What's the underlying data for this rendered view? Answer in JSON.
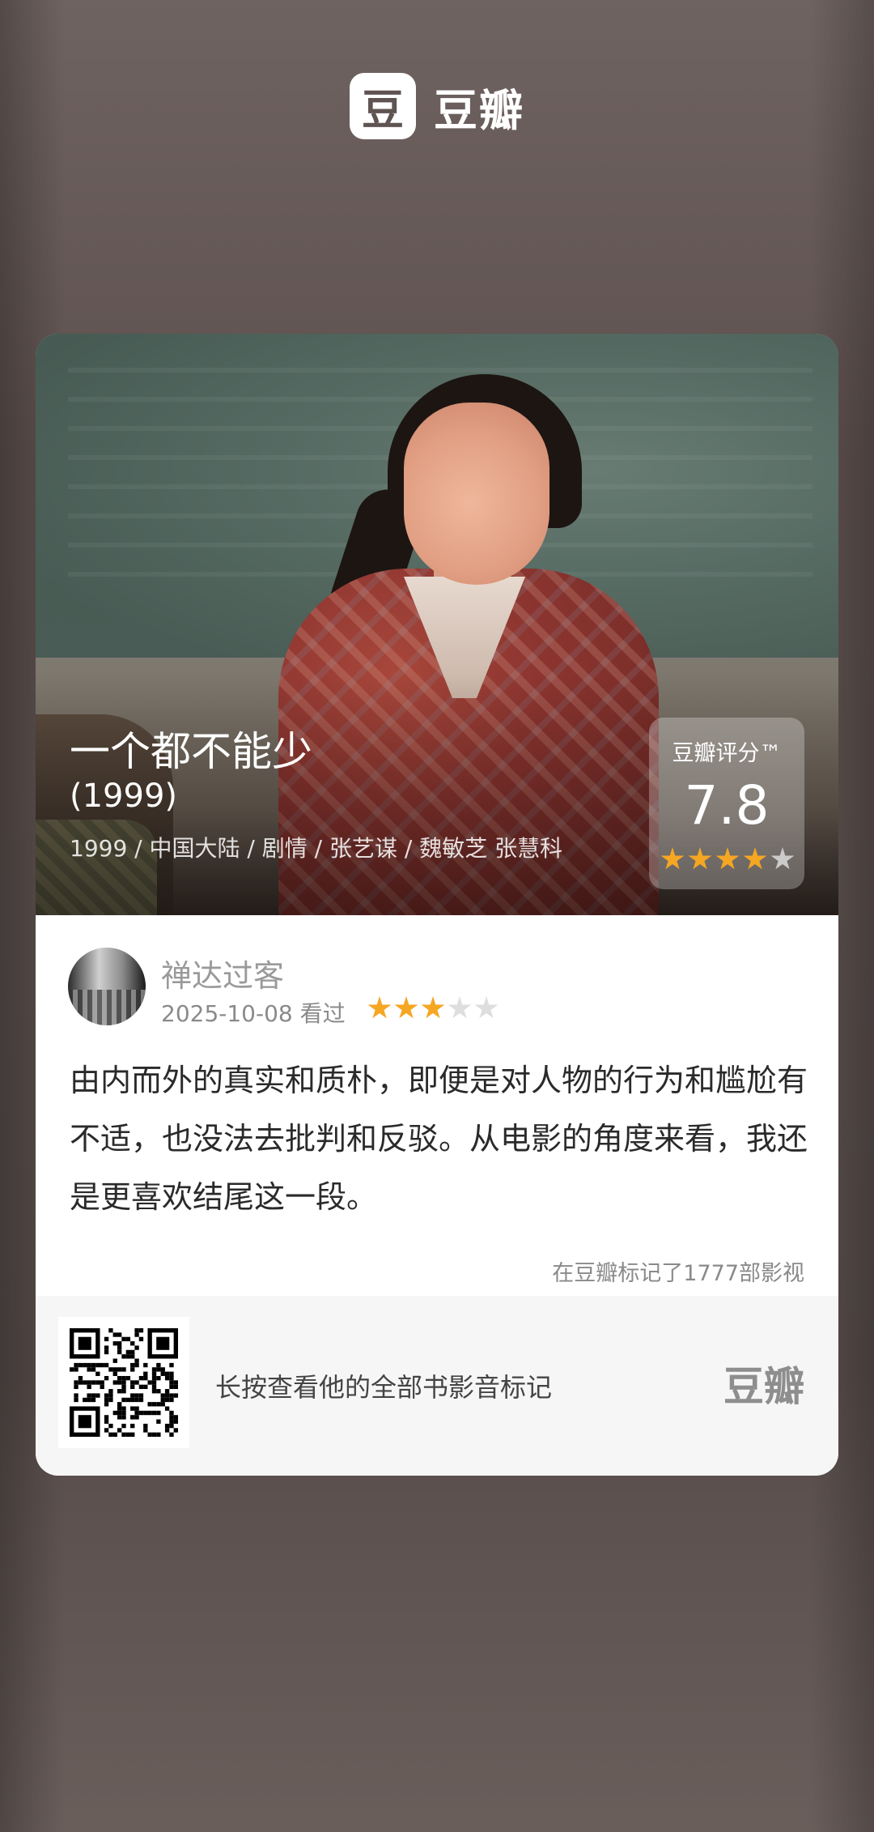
{
  "app": {
    "brand_icon_char": "豆",
    "brand_name": "豆瓣"
  },
  "movie": {
    "title": "一个都不能少",
    "year": "(1999)",
    "meta": "1999 / 中国大陆 / 剧情 / 张艺谋 / 魏敏芝 张慧科",
    "rating_label": "豆瓣评分™",
    "rating_value": "7.8",
    "rating_stars": 4
  },
  "review": {
    "user_name": "禅达过客",
    "date_status": "2025-10-08 看过",
    "user_stars": 3,
    "text": "由内而外的真实和质朴，即便是对人物的行为和尴尬有不适，也没法去批判和反驳。从电影的角度来看，我还是更喜欢结尾这一段。",
    "mark_count": "在豆瓣标记了1777部影视"
  },
  "footer": {
    "prompt": "长按查看他的全部书影音标记",
    "logo": "豆瓣"
  },
  "colors": {
    "star_on": "#f5a623",
    "star_off": "#dedede",
    "background": "#5d504e"
  }
}
